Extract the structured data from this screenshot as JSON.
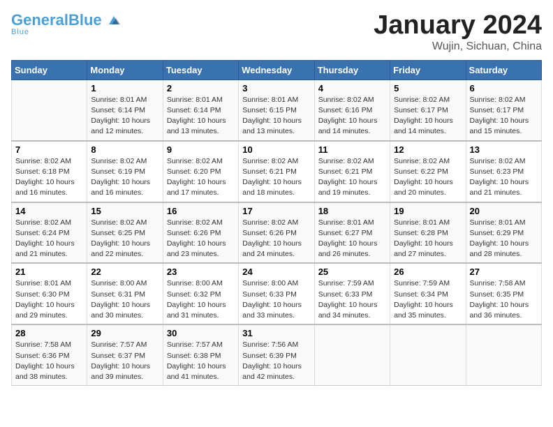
{
  "header": {
    "logo_general": "General",
    "logo_blue": "Blue",
    "title": "January 2024",
    "subtitle": "Wujin, Sichuan, China"
  },
  "days_of_week": [
    "Sunday",
    "Monday",
    "Tuesday",
    "Wednesday",
    "Thursday",
    "Friday",
    "Saturday"
  ],
  "weeks": [
    [
      {
        "day": "",
        "sunrise": "",
        "sunset": "",
        "daylight": ""
      },
      {
        "day": "1",
        "sunrise": "Sunrise: 8:01 AM",
        "sunset": "Sunset: 6:14 PM",
        "daylight": "Daylight: 10 hours and 12 minutes."
      },
      {
        "day": "2",
        "sunrise": "Sunrise: 8:01 AM",
        "sunset": "Sunset: 6:14 PM",
        "daylight": "Daylight: 10 hours and 13 minutes."
      },
      {
        "day": "3",
        "sunrise": "Sunrise: 8:01 AM",
        "sunset": "Sunset: 6:15 PM",
        "daylight": "Daylight: 10 hours and 13 minutes."
      },
      {
        "day": "4",
        "sunrise": "Sunrise: 8:02 AM",
        "sunset": "Sunset: 6:16 PM",
        "daylight": "Daylight: 10 hours and 14 minutes."
      },
      {
        "day": "5",
        "sunrise": "Sunrise: 8:02 AM",
        "sunset": "Sunset: 6:17 PM",
        "daylight": "Daylight: 10 hours and 14 minutes."
      },
      {
        "day": "6",
        "sunrise": "Sunrise: 8:02 AM",
        "sunset": "Sunset: 6:17 PM",
        "daylight": "Daylight: 10 hours and 15 minutes."
      }
    ],
    [
      {
        "day": "7",
        "sunrise": "Sunrise: 8:02 AM",
        "sunset": "Sunset: 6:18 PM",
        "daylight": "Daylight: 10 hours and 16 minutes."
      },
      {
        "day": "8",
        "sunrise": "Sunrise: 8:02 AM",
        "sunset": "Sunset: 6:19 PM",
        "daylight": "Daylight: 10 hours and 16 minutes."
      },
      {
        "day": "9",
        "sunrise": "Sunrise: 8:02 AM",
        "sunset": "Sunset: 6:20 PM",
        "daylight": "Daylight: 10 hours and 17 minutes."
      },
      {
        "day": "10",
        "sunrise": "Sunrise: 8:02 AM",
        "sunset": "Sunset: 6:21 PM",
        "daylight": "Daylight: 10 hours and 18 minutes."
      },
      {
        "day": "11",
        "sunrise": "Sunrise: 8:02 AM",
        "sunset": "Sunset: 6:21 PM",
        "daylight": "Daylight: 10 hours and 19 minutes."
      },
      {
        "day": "12",
        "sunrise": "Sunrise: 8:02 AM",
        "sunset": "Sunset: 6:22 PM",
        "daylight": "Daylight: 10 hours and 20 minutes."
      },
      {
        "day": "13",
        "sunrise": "Sunrise: 8:02 AM",
        "sunset": "Sunset: 6:23 PM",
        "daylight": "Daylight: 10 hours and 21 minutes."
      }
    ],
    [
      {
        "day": "14",
        "sunrise": "Sunrise: 8:02 AM",
        "sunset": "Sunset: 6:24 PM",
        "daylight": "Daylight: 10 hours and 21 minutes."
      },
      {
        "day": "15",
        "sunrise": "Sunrise: 8:02 AM",
        "sunset": "Sunset: 6:25 PM",
        "daylight": "Daylight: 10 hours and 22 minutes."
      },
      {
        "day": "16",
        "sunrise": "Sunrise: 8:02 AM",
        "sunset": "Sunset: 6:26 PM",
        "daylight": "Daylight: 10 hours and 23 minutes."
      },
      {
        "day": "17",
        "sunrise": "Sunrise: 8:02 AM",
        "sunset": "Sunset: 6:26 PM",
        "daylight": "Daylight: 10 hours and 24 minutes."
      },
      {
        "day": "18",
        "sunrise": "Sunrise: 8:01 AM",
        "sunset": "Sunset: 6:27 PM",
        "daylight": "Daylight: 10 hours and 26 minutes."
      },
      {
        "day": "19",
        "sunrise": "Sunrise: 8:01 AM",
        "sunset": "Sunset: 6:28 PM",
        "daylight": "Daylight: 10 hours and 27 minutes."
      },
      {
        "day": "20",
        "sunrise": "Sunrise: 8:01 AM",
        "sunset": "Sunset: 6:29 PM",
        "daylight": "Daylight: 10 hours and 28 minutes."
      }
    ],
    [
      {
        "day": "21",
        "sunrise": "Sunrise: 8:01 AM",
        "sunset": "Sunset: 6:30 PM",
        "daylight": "Daylight: 10 hours and 29 minutes."
      },
      {
        "day": "22",
        "sunrise": "Sunrise: 8:00 AM",
        "sunset": "Sunset: 6:31 PM",
        "daylight": "Daylight: 10 hours and 30 minutes."
      },
      {
        "day": "23",
        "sunrise": "Sunrise: 8:00 AM",
        "sunset": "Sunset: 6:32 PM",
        "daylight": "Daylight: 10 hours and 31 minutes."
      },
      {
        "day": "24",
        "sunrise": "Sunrise: 8:00 AM",
        "sunset": "Sunset: 6:33 PM",
        "daylight": "Daylight: 10 hours and 33 minutes."
      },
      {
        "day": "25",
        "sunrise": "Sunrise: 7:59 AM",
        "sunset": "Sunset: 6:33 PM",
        "daylight": "Daylight: 10 hours and 34 minutes."
      },
      {
        "day": "26",
        "sunrise": "Sunrise: 7:59 AM",
        "sunset": "Sunset: 6:34 PM",
        "daylight": "Daylight: 10 hours and 35 minutes."
      },
      {
        "day": "27",
        "sunrise": "Sunrise: 7:58 AM",
        "sunset": "Sunset: 6:35 PM",
        "daylight": "Daylight: 10 hours and 36 minutes."
      }
    ],
    [
      {
        "day": "28",
        "sunrise": "Sunrise: 7:58 AM",
        "sunset": "Sunset: 6:36 PM",
        "daylight": "Daylight: 10 hours and 38 minutes."
      },
      {
        "day": "29",
        "sunrise": "Sunrise: 7:57 AM",
        "sunset": "Sunset: 6:37 PM",
        "daylight": "Daylight: 10 hours and 39 minutes."
      },
      {
        "day": "30",
        "sunrise": "Sunrise: 7:57 AM",
        "sunset": "Sunset: 6:38 PM",
        "daylight": "Daylight: 10 hours and 41 minutes."
      },
      {
        "day": "31",
        "sunrise": "Sunrise: 7:56 AM",
        "sunset": "Sunset: 6:39 PM",
        "daylight": "Daylight: 10 hours and 42 minutes."
      },
      {
        "day": "",
        "sunrise": "",
        "sunset": "",
        "daylight": ""
      },
      {
        "day": "",
        "sunrise": "",
        "sunset": "",
        "daylight": ""
      },
      {
        "day": "",
        "sunrise": "",
        "sunset": "",
        "daylight": ""
      }
    ]
  ]
}
